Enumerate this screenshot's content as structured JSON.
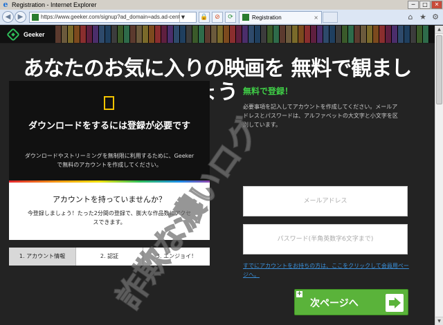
{
  "browser": {
    "window_title": "Registration - Internet Explorer",
    "address_url": "https://www.geeker.com/signup?ad_domain=ads.ad-centr",
    "tab_label": "Registration",
    "tab_close": "×",
    "minimize": "─",
    "maximize": "□",
    "close": "✕"
  },
  "site": {
    "brand": "Geeker"
  },
  "hero": {
    "title": "あなたのお気に入りの映画を 無料で観ましょう"
  },
  "left_panel": {
    "heading": "ダウンロードをするには登録が必要です",
    "text": "ダウンロードやストリーミングを無制限に利用するために、Geekerで無料のアカウントを作成してください。",
    "no_account_heading": "アカウントを持っていませんか？",
    "no_account_text": "今登録しましょう！たった2分間の登録で、膨大な作品数にアクセスできます。"
  },
  "steps": [
    "1. アカウント情報",
    "2. 認証",
    "3. エンジョイ！"
  ],
  "right_panel": {
    "title": "無料で登録！",
    "desc": "必要事項を記入してアカウントを作成してください。メールアドレスとパスワードは、アルファベットの大文字と小文字を区別しています。",
    "email_placeholder": "メールアドレス",
    "password_placeholder": "パスワード(半角英数字6文字まで)",
    "member_link": "すでにアカウントをお持ちの方は、ここをクリックして会員用ページへ。",
    "next_button": "次ページへ"
  },
  "watermark": "詐欺な濃いログ",
  "colors": {
    "accent_green": "#3fcf47",
    "button_green": "#5ab33a",
    "link_blue": "#3a8fd9",
    "phone_yellow": "#f5c400"
  },
  "icons": [
    "ie-logo-icon",
    "back-icon",
    "forward-icon",
    "lock-icon",
    "refresh-icon",
    "home-icon",
    "star-icon",
    "gear-icon",
    "phone-icon",
    "arrow-right-icon"
  ]
}
